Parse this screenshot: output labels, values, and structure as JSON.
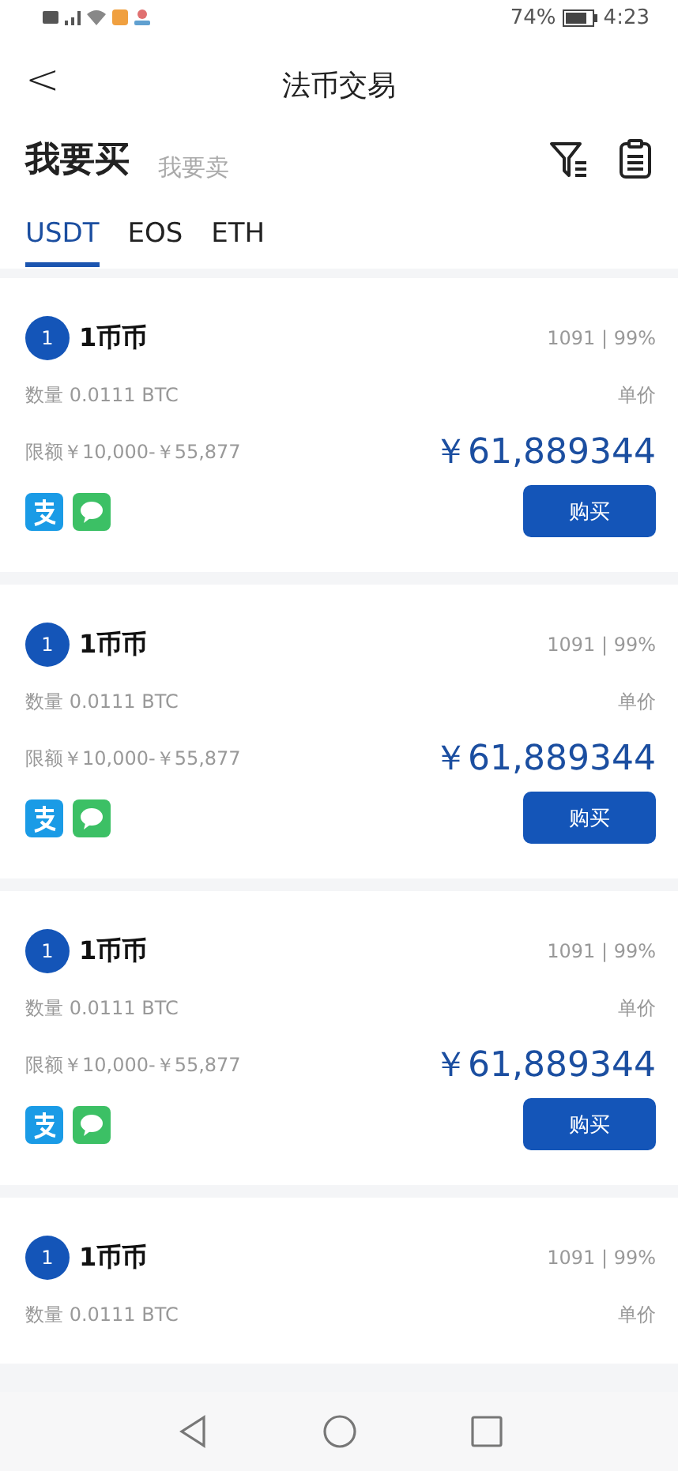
{
  "status_bar": {
    "battery": "74%",
    "time": "4:23"
  },
  "header": {
    "back": "<",
    "title": "法币交易"
  },
  "modes": [
    {
      "label": "我要买",
      "selected": true
    },
    {
      "label": "我要卖",
      "selected": false
    }
  ],
  "tabs": [
    {
      "label": "USDT",
      "selected": true
    },
    {
      "label": "EOS",
      "selected": false
    },
    {
      "label": "ETH",
      "selected": false
    }
  ],
  "orders": [
    {
      "rank": "1",
      "merchant": "1币币",
      "stats": "1091 | 99%",
      "quantity": "数量 0.0111 BTC",
      "unit_label": "单价",
      "limit": "限额￥10,000-￥55,877",
      "price": "￥61,889344",
      "button": "购买"
    },
    {
      "rank": "1",
      "merchant": "1币币",
      "stats": "1091 | 99%",
      "quantity": "数量 0.0111 BTC",
      "unit_label": "单价",
      "limit": "限额￥10,000-￥55,877",
      "price": "￥61,889344",
      "button": "购买"
    },
    {
      "rank": "1",
      "merchant": "1币币",
      "stats": "1091 | 99%",
      "quantity": "数量 0.0111 BTC",
      "unit_label": "单价",
      "limit": "限额￥10,000-￥55,877",
      "price": "￥61,889344",
      "button": "购买"
    },
    {
      "rank": "1",
      "merchant": "1币币",
      "stats": "1091 | 99%",
      "quantity": "数量 0.0111 BTC",
      "unit_label": "单价"
    }
  ]
}
